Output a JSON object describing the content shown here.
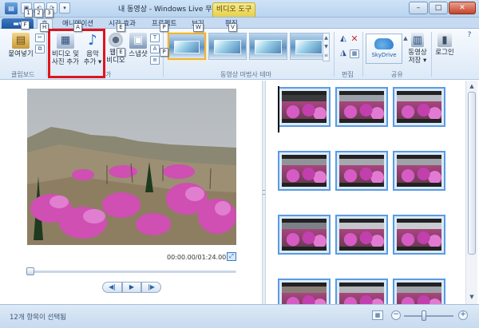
{
  "window": {
    "title": "내 동영상 - Windows Live 무비 메이커",
    "contextual_tab": "비디오 도구",
    "controls": {
      "minimize": "–",
      "maximize": "□",
      "close": "✕"
    }
  },
  "quick_access": {
    "app_icon": "app-menu-icon",
    "items": [
      "save-icon",
      "undo-icon",
      "redo-icon",
      "dropdown-icon"
    ]
  },
  "keytips": {
    "qat": [
      "1",
      "2",
      "3"
    ],
    "file": "F",
    "home": "H",
    "animation": "A",
    "visual_effects": "E",
    "project": "P",
    "view": "W",
    "edit": "V"
  },
  "tabs": [
    {
      "label": "홈"
    },
    {
      "label": "애니메이션"
    },
    {
      "label": "시각 효과"
    },
    {
      "label": "프로젝트"
    },
    {
      "label": "보기"
    },
    {
      "label": "편집"
    }
  ],
  "ribbon": {
    "clipboard": {
      "paste": "붙여넣기",
      "group": "클립보드"
    },
    "add": {
      "add_videos_line1": "비디오 및",
      "add_videos_line2": "사진 추가",
      "add_music_line1": "음악",
      "add_music_line2": "추가 ▾",
      "webcam_line1": "웹캠",
      "webcam_line2": "비디오",
      "snapshot": "스냅샷",
      "group_suffix": "가"
    },
    "themes": {
      "group": "동영상 마법사 테마",
      "count": 4,
      "selected_index": 0
    },
    "editing": {
      "group": "편집"
    },
    "share": {
      "skydrive": "SkyDrive",
      "save_line1": "동영상",
      "save_line2": "저장 ▾",
      "signin": "로그인",
      "group": "공유"
    }
  },
  "preview": {
    "time": "00:00.00/01:24.00",
    "seek_position": 0.0,
    "transport": {
      "prev": "◀|",
      "play": "▶",
      "next": "|▶"
    }
  },
  "storyboard": {
    "clip_count": 12,
    "clips": [
      {
        "top": "#3a3b3c",
        "ground": "#6b4a4e"
      },
      {
        "top": "#9aa1a8",
        "ground": "#b04a9a"
      },
      {
        "top": "#b8bcc2",
        "ground": "#c44fb8"
      },
      {
        "top": "#8f9499",
        "ground": "#b548a6"
      },
      {
        "top": "#a4a9ae",
        "ground": "#cc5ab9"
      },
      {
        "top": "#9fa3a8",
        "ground": "#c550b0"
      },
      {
        "top": "#7c8187",
        "ground": "#b84a9e"
      },
      {
        "top": "#c3c7cb",
        "ground": "#8c6b6f"
      },
      {
        "top": "#c9cdd1",
        "ground": "#d16ac4"
      },
      {
        "top": "#8a7d78",
        "ground": "#a14a8c"
      },
      {
        "top": "#b1b5ba",
        "ground": "#b64fa4"
      },
      {
        "top": "#9da2a7",
        "ground": "#c253b2"
      }
    ]
  },
  "status": {
    "text": "12개 항목이 선택됨",
    "zoom_level": 0.4,
    "zoom_out": "−",
    "zoom_in": "+"
  }
}
